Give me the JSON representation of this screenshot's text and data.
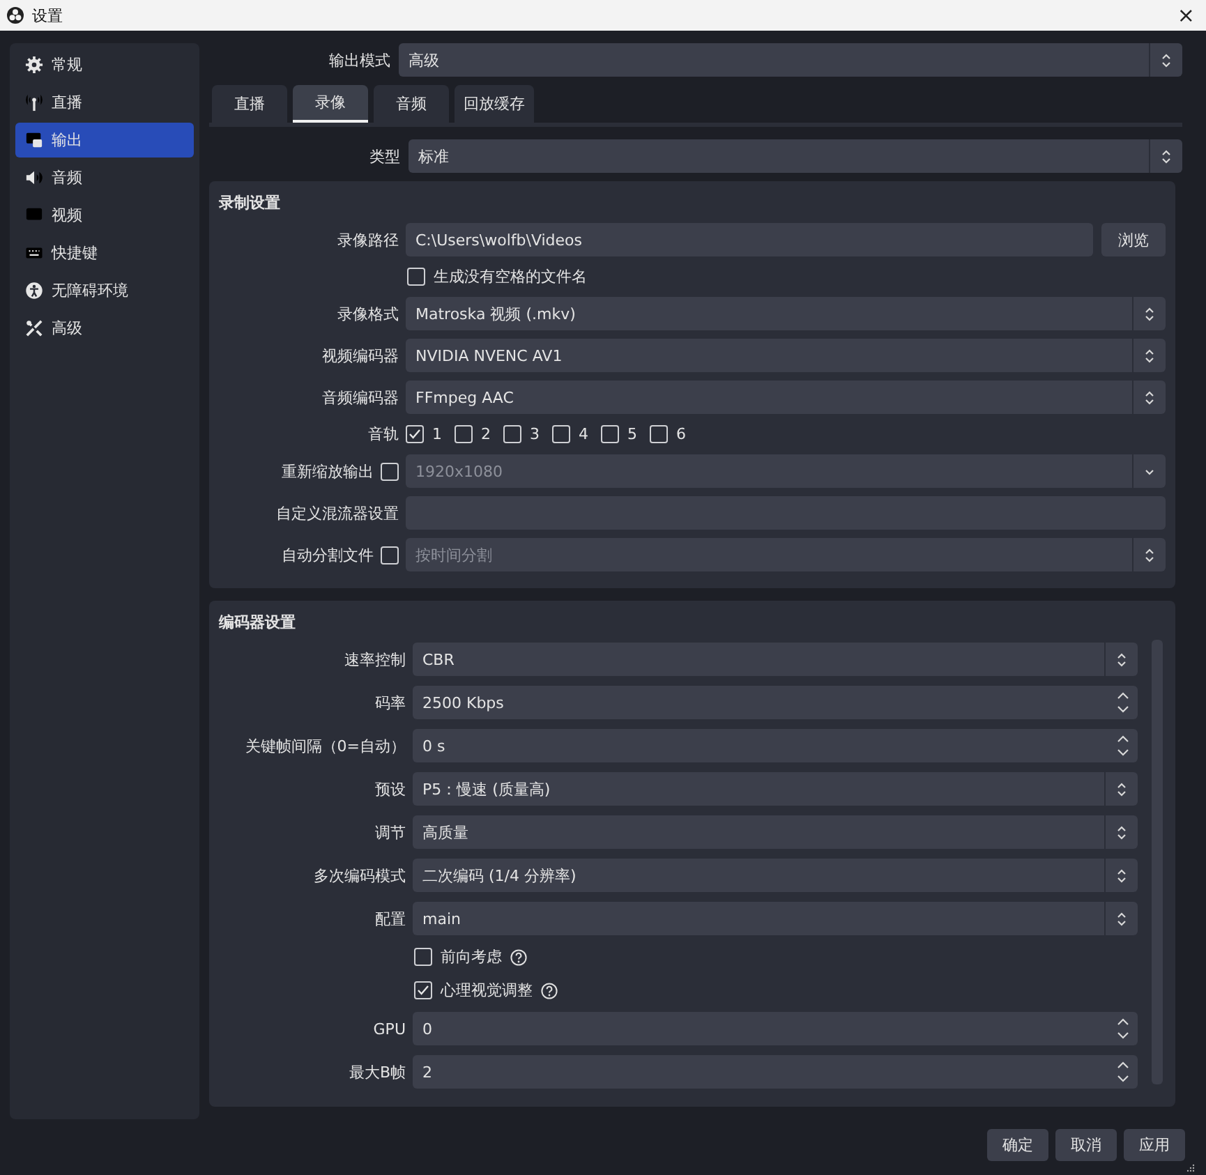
{
  "window": {
    "title": "设置",
    "close": "×"
  },
  "sidebar": {
    "items": [
      {
        "label": "常规",
        "selected": false
      },
      {
        "label": "直播",
        "selected": false
      },
      {
        "label": "输出",
        "selected": true
      },
      {
        "label": "音频",
        "selected": false
      },
      {
        "label": "视频",
        "selected": false
      },
      {
        "label": "快捷键",
        "selected": false
      },
      {
        "label": "无障碍环境",
        "selected": false
      },
      {
        "label": "高级",
        "selected": false
      }
    ]
  },
  "output_mode": {
    "label": "输出模式",
    "value": "高级"
  },
  "tabs": [
    {
      "label": "直播",
      "selected": false
    },
    {
      "label": "录像",
      "selected": true
    },
    {
      "label": "音频",
      "selected": false
    },
    {
      "label": "回放缓存",
      "selected": false
    }
  ],
  "type": {
    "label": "类型",
    "value": "标准"
  },
  "recording": {
    "title": "录制设置",
    "rows": [
      {
        "kind": "path",
        "label": "录像路径",
        "value": "C:\\Users\\wolfb\\Videos",
        "button": "浏览"
      },
      {
        "kind": "checkbox",
        "label": "生成没有空格的文件名",
        "checked": false
      },
      {
        "kind": "select",
        "label": "录像格式",
        "value": "Matroska 视频 (.mkv)"
      },
      {
        "kind": "select",
        "label": "视频编码器",
        "value": "NVIDIA NVENC AV1"
      },
      {
        "kind": "select",
        "label": "音频编码器",
        "value": "FFmpeg AAC"
      },
      {
        "kind": "tracks",
        "label": "音轨",
        "tracks": [
          {
            "label": "1",
            "checked": true
          },
          {
            "label": "2",
            "checked": false
          },
          {
            "label": "3",
            "checked": false
          },
          {
            "label": "4",
            "checked": false
          },
          {
            "label": "5",
            "checked": false
          },
          {
            "label": "6",
            "checked": false
          }
        ]
      },
      {
        "kind": "combo",
        "label": "重新缩放输出",
        "checked": false,
        "value": "1920x1080",
        "disabled": true
      },
      {
        "kind": "text",
        "label": "自定义混流器设置"
      },
      {
        "kind": "select",
        "label": "自动分割文件",
        "checked": false,
        "value": "按时间分割",
        "disabled": true
      }
    ]
  },
  "encoder": {
    "title": "编码器设置",
    "rows": [
      {
        "kind": "select",
        "label": "速率控制",
        "value": "CBR"
      },
      {
        "kind": "spin",
        "label": "码率",
        "value": "2500 Kbps"
      },
      {
        "kind": "spin",
        "label": "关键帧间隔（0=自动）",
        "value": "0 s"
      },
      {
        "kind": "select",
        "label": "预设",
        "value": "P5：慢速 (质量高)"
      },
      {
        "kind": "select",
        "label": "调节",
        "value": "高质量"
      },
      {
        "kind": "select",
        "label": "多次编码模式",
        "value": "二次编码 (1/4 分辨率)"
      },
      {
        "kind": "select",
        "label": "配置",
        "value": "main"
      },
      {
        "kind": "checkbox",
        "label": "前向考虑",
        "checked": false,
        "help": true
      },
      {
        "kind": "checkbox",
        "label": "心理视觉调整",
        "checked": true,
        "help": true
      },
      {
        "kind": "spin",
        "label": "GPU",
        "value": "0"
      },
      {
        "kind": "spin",
        "label": "最大B帧",
        "value": "2"
      }
    ]
  },
  "buttons": [
    "确定",
    "取消",
    "应用"
  ]
}
